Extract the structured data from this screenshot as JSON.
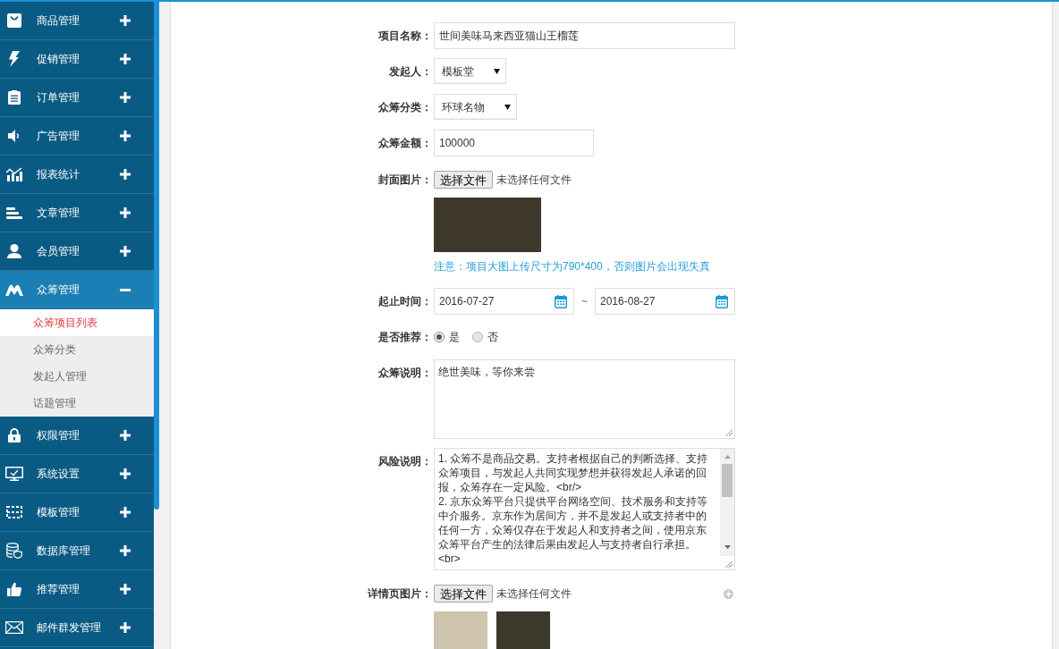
{
  "sidebar": {
    "menus": [
      {
        "label": "商品管理",
        "expanded": false
      },
      {
        "label": "促销管理",
        "expanded": false
      },
      {
        "label": "订单管理",
        "expanded": false
      },
      {
        "label": "广告管理",
        "expanded": false
      },
      {
        "label": "报表统计",
        "expanded": false
      },
      {
        "label": "文章管理",
        "expanded": false
      },
      {
        "label": "会员管理",
        "expanded": false
      },
      {
        "label": "众筹管理",
        "expanded": true,
        "children": [
          {
            "label": "众筹项目列表",
            "selected": true
          },
          {
            "label": "众筹分类",
            "selected": false
          },
          {
            "label": "发起人管理",
            "selected": false
          },
          {
            "label": "话题管理",
            "selected": false
          }
        ]
      },
      {
        "label": "权限管理",
        "expanded": false
      },
      {
        "label": "系统设置",
        "expanded": false
      },
      {
        "label": "模板管理",
        "expanded": false
      },
      {
        "label": "数据库管理",
        "expanded": false
      },
      {
        "label": "推荐管理",
        "expanded": false
      },
      {
        "label": "邮件群发管理",
        "expanded": false
      }
    ]
  },
  "form": {
    "fields": [
      {
        "kind": "text",
        "label": "项目名称：",
        "value": "世间美味马来西亚猫山王榴莲"
      },
      {
        "kind": "select",
        "label": "发起人：",
        "value": "模板堂"
      },
      {
        "kind": "select",
        "label": "众筹分类：",
        "value": "环球名物"
      },
      {
        "kind": "number",
        "label": "众筹金额：",
        "value": "100000"
      },
      {
        "kind": "file",
        "label": "封面图片：",
        "button": "选择文件",
        "status": "未选择任何文件",
        "addable": false,
        "thumbnails": [
          {
            "kind": "banner"
          }
        ],
        "note": "注意：项目大图上传尺寸为790*400，否则图片会出现失真"
      },
      {
        "kind": "daterange",
        "label": "起止时间：",
        "start": "2016-07-27",
        "separator": "~",
        "end": "2016-08-27"
      },
      {
        "kind": "radio",
        "label": "是否推荐：",
        "options": [
          {
            "label": "是",
            "selected": true
          },
          {
            "label": "否",
            "selected": false
          }
        ]
      },
      {
        "kind": "textarea",
        "label": "众筹说明：",
        "value": "绝世美味，等你来尝",
        "scrollable": false
      },
      {
        "kind": "textarea",
        "label": "风险说明：",
        "value": "1. 众筹不是商品交易。支持者根据自己的判断选择、支持众筹项目，与发起人共同实现梦想并获得发起人承诺的回报，众筹存在一定风险。<br/>\n2. 京东众筹平台只提供平台网络空间、技术服务和支持等中介服务。京东作为居间方，并不是发起人或支持者中的任何一方，众筹仅存在于发起人和支持者之间，使用京东众筹平台产生的法律后果由发起人与支持者自行承担。\n<br>",
        "scrollable": true
      },
      {
        "kind": "file",
        "label": "详情页图片：",
        "button": "选择文件",
        "status": "未选择任何文件",
        "addable": true,
        "thumbnails": [
          {
            "kind": "thumb"
          },
          {
            "kind": "thumb"
          }
        ]
      }
    ]
  }
}
